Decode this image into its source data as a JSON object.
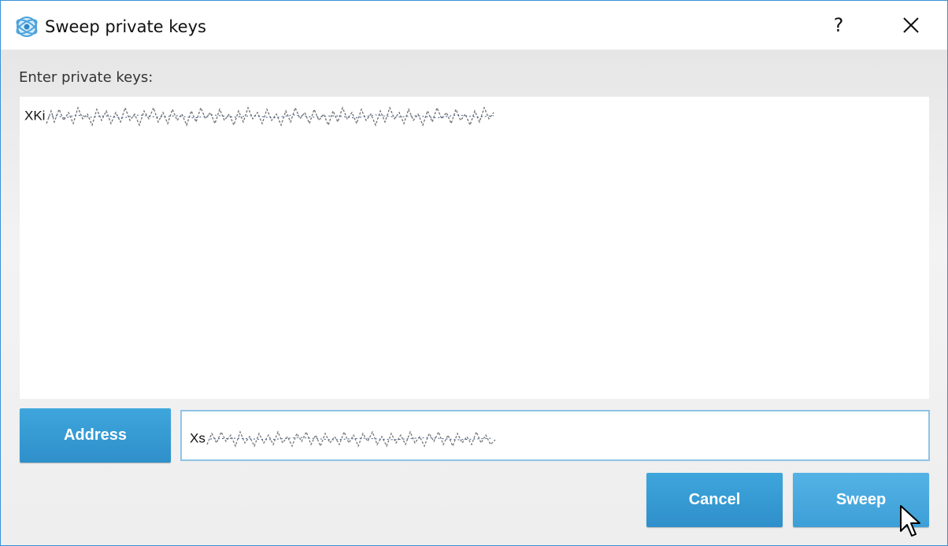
{
  "window": {
    "title": "Sweep private keys",
    "help_label": "?",
    "accent_color": "#3ea6dc"
  },
  "icons": {
    "app": "dash-app-icon",
    "close": "close-icon",
    "help": "help-icon",
    "cursor": "mouse-pointer-icon"
  },
  "form": {
    "keys_label": "Enter private keys:",
    "keys_value_prefix": "XKi",
    "address_button_label": "Address",
    "address_value_prefix": "Xs"
  },
  "actions": {
    "cancel_label": "Cancel",
    "sweep_label": "Sweep"
  }
}
